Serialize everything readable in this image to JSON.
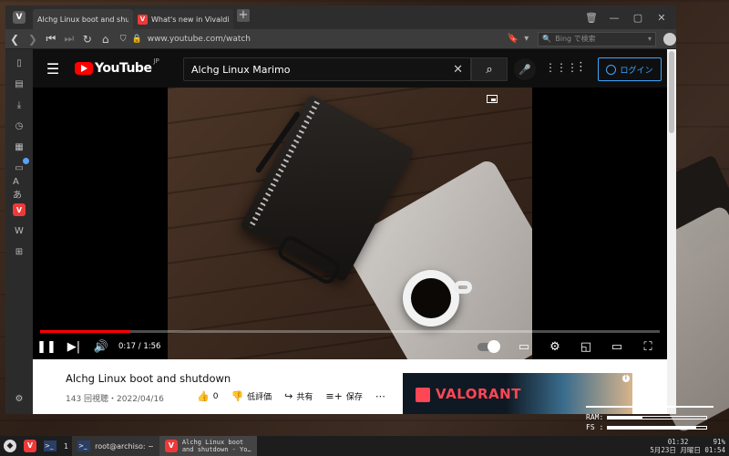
{
  "browser": {
    "tabs": [
      {
        "title": "Alchg Linux boot and shutd",
        "favicon": "youtube-favicon",
        "active": true
      },
      {
        "title": "What's new in Vivaldi | Viva",
        "favicon": "vivaldi-favicon",
        "active": false
      }
    ],
    "url": "www.youtube.com/watch",
    "search_placeholder": "Bing で検索"
  },
  "youtube": {
    "logo_text": "YouTube",
    "region": "JP",
    "search_value": "Alchg Linux Marimo",
    "login_label": "ログイン",
    "player": {
      "current_time": "0:17",
      "duration": "1:56",
      "time_display": "0:17 / 1:56",
      "progress": 0.146
    },
    "video": {
      "title": "Alchg Linux boot and shutdown",
      "meta": "143 回視聴・2022/04/16",
      "likes": "0",
      "dislike_label": "低評価",
      "share_label": "共有",
      "save_label": "保存"
    },
    "ad": {
      "brand": "VALORANT"
    }
  },
  "conky": {
    "ram_label": "RAM:",
    "fs_label": "FS :",
    "ram_fraction": 0.35,
    "fs_fraction": 0.9
  },
  "taskbar": {
    "workspace": "1",
    "terminal_label": "root@archiso: ~",
    "browser_task_label": "Alchg Linux boot\nand shutdown - Yo…",
    "time": "01:32",
    "battery": "91%",
    "date": "5月23日 月曜日",
    "time_small": "01:54"
  },
  "colors": {
    "youtube_red": "#ff0000",
    "vivaldi_red": "#ef3939",
    "login_blue": "#3ea6ff",
    "valorant_red": "#ff4655"
  }
}
